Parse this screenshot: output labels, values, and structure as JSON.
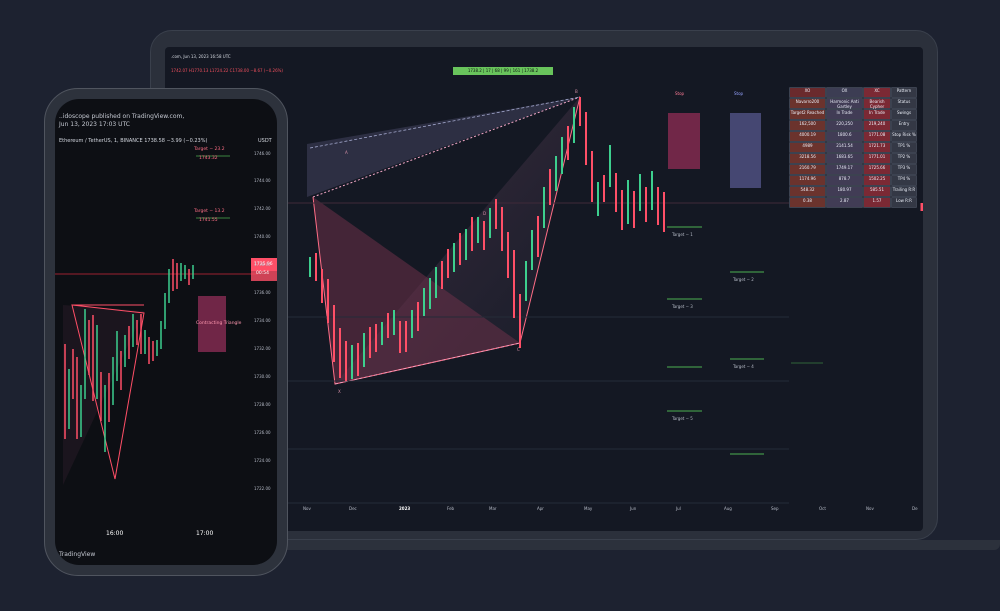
{
  "laptop": {
    "header": ".com, Jun 13, 2023 16:58 UTC",
    "ohlc": "1742.07 H1770.13 L1724.22 C1738.00 −8.67 (−0.26%)",
    "green_badge": "1738.2 | 17 | 68 | 99 | 161 | 1738.2",
    "months": [
      "Nov",
      "Dec",
      "2023",
      "Feb",
      "Mar",
      "Apr",
      "May",
      "Jun",
      "Jul",
      "Aug",
      "Sep",
      "Oct",
      "Nov",
      "De"
    ],
    "table_rows": [
      [
        "XO",
        "OX",
        "XC",
        "Pattern"
      ],
      [
        "Navarro200",
        "Harmonic Anti Gartley",
        "Bearish Cypher",
        "Status"
      ],
      [
        "Target2 Reached",
        "In Trade",
        "In Trade",
        "Swings"
      ],
      [
        "162,500",
        "220,250",
        "219,240",
        "Entry"
      ],
      [
        "4000.19",
        "1800.6",
        "1771.08",
        "Stop Risk %"
      ],
      [
        "4989",
        "2141.54",
        "1721.73",
        "TP1 %"
      ],
      [
        "3218.56",
        "1683.65",
        "1771.01",
        "TP2 %"
      ],
      [
        "2160.79",
        "1749.17",
        "1725.66",
        "TP3 %"
      ],
      [
        "1174.96",
        "878.7",
        "1502.25",
        "TP4 %"
      ],
      [
        "548.32",
        "180.97",
        "585.51",
        "Trailing R:R"
      ],
      [
        "0.38",
        "2.87",
        "1.57",
        "Low R:R"
      ]
    ],
    "axis_labels": [
      "Target − 1",
      "Target − 2",
      "Target − 3",
      "Target − 4",
      "Target − 5"
    ],
    "stop_labels": [
      "Stop",
      "Stop"
    ],
    "points": [
      "X",
      "A",
      "B",
      "C",
      "D"
    ]
  },
  "phone": {
    "header1": "..idoscope published on TradingView.com,",
    "header2": "Jun 13, 2023 17:03 UTC",
    "symbol": "Ethereum / TetherUS, 1, BINANCE  1738.58  −3.99 (−0.23%)",
    "currency": "USDT",
    "price_ticks": [
      "1746.00",
      "1744.00",
      "1742.00",
      "1740.00",
      "1738.00",
      "1736.00",
      "1734.00",
      "1732.00",
      "1730.00",
      "1728.00",
      "1726.00",
      "1724.00",
      "1722.00"
    ],
    "price_tag": "1735.96",
    "price_tag2": "00:54",
    "target_labels": [
      "Target − 23.2",
      "1743.32",
      "Target − 13.2",
      "1741.55"
    ],
    "zone_label": "Contracting Triangle",
    "times": [
      "16:00",
      "17:00"
    ],
    "footer": "TradingView"
  }
}
